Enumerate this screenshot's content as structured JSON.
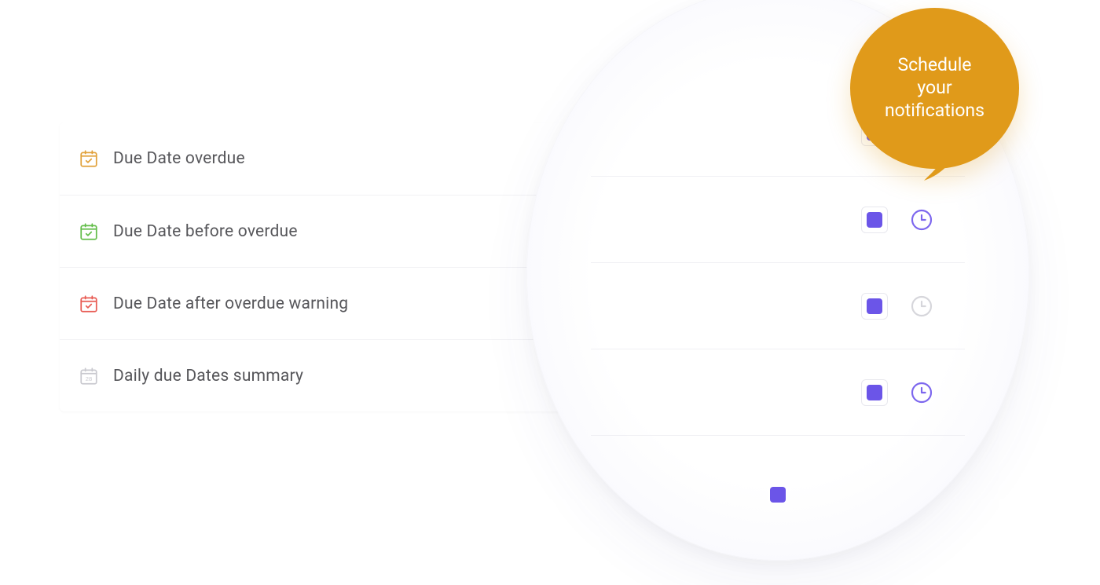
{
  "colors": {
    "accent": "#6b55e8",
    "row0": "#e1a13a",
    "row1": "#63bd4a",
    "row2": "#e85c54",
    "row3": "#c9c9cf",
    "clock_active": "#7c66ee",
    "clock_muted": "#d6d6db",
    "callout_bg": "#e09a1a"
  },
  "rows": [
    {
      "icon": "calendar-check",
      "label": "Due Date overdue"
    },
    {
      "icon": "calendar-check",
      "label": "Due Date before overdue"
    },
    {
      "icon": "calendar-check",
      "label": "Due Date after overdue warning"
    },
    {
      "icon": "calendar-28",
      "label": "Daily due Dates summary"
    }
  ],
  "zoom": {
    "rows": [
      {
        "checked": true,
        "clock": "muted"
      },
      {
        "checked": true,
        "clock": "active"
      },
      {
        "checked": true,
        "clock": "muted"
      },
      {
        "checked": true,
        "clock": "active"
      }
    ],
    "tail_checked": true
  },
  "callout": {
    "line1": "Schedule",
    "line2": "your",
    "line3": "notifications"
  }
}
